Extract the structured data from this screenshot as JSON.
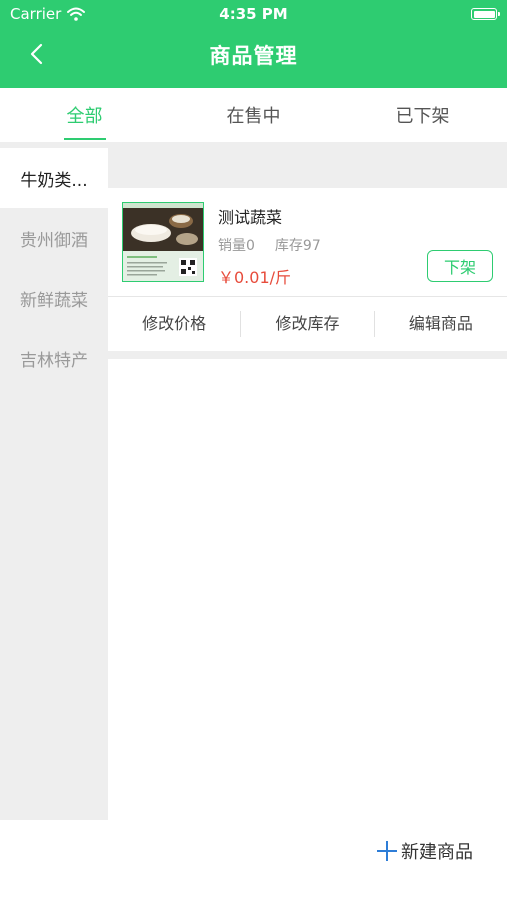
{
  "status_bar": {
    "carrier": "Carrier",
    "time": "4:35 PM"
  },
  "nav": {
    "title": "商品管理"
  },
  "tabs": [
    {
      "label": "全部",
      "active": true
    },
    {
      "label": "在售中",
      "active": false
    },
    {
      "label": "已下架",
      "active": false
    }
  ],
  "sidebar": {
    "items": [
      {
        "label": "牛奶类...",
        "active": true
      },
      {
        "label": "贵州御酒",
        "active": false
      },
      {
        "label": "新鲜蔬菜",
        "active": false
      },
      {
        "label": "吉林特产",
        "active": false
      }
    ]
  },
  "product": {
    "name": "测试蔬菜",
    "sales": "销量0",
    "stock": "库存97",
    "price": "￥0.01/斤",
    "delist_label": "下架",
    "actions": [
      "修改价格",
      "修改库存",
      "编辑商品"
    ]
  },
  "footer": {
    "new_product_label": "新建商品"
  },
  "colors": {
    "brand": "#2ecc71",
    "price": "#e74c3c",
    "plus": "#2e7dd7"
  }
}
